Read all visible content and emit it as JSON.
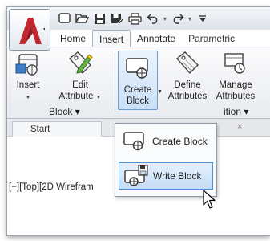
{
  "quick_access": {
    "icons": [
      "new-file-icon",
      "open-folder-icon",
      "save-icon",
      "save-as-icon",
      "print-icon",
      "undo-icon",
      "redo-icon",
      "customize-dropdown-icon"
    ]
  },
  "tabs": [
    {
      "label": "Home",
      "active": false
    },
    {
      "label": "Insert",
      "active": true
    },
    {
      "label": "Annotate",
      "active": false
    },
    {
      "label": "Parametric",
      "active": false
    }
  ],
  "ribbon": {
    "insert_label": "Insert",
    "edit_attr_line1": "Edit",
    "edit_attr_line2": "Attribute",
    "create_block_line1": "Create",
    "create_block_line2": "Block",
    "define_attr_line1": "Define",
    "define_attr_line2": "Attributes",
    "manage_attr_line1": "Manage",
    "manage_attr_line2": "Attributes",
    "panel_block": "Block ▾",
    "panel_definition": "ition ▾"
  },
  "document": {
    "tab_label": "Start",
    "viewport_label": "[−][Top][2D Wirefram"
  },
  "dropdown": {
    "items": [
      {
        "label": "Create Block",
        "highlighted": false
      },
      {
        "label": "Write Block",
        "highlighted": true
      }
    ]
  },
  "colors": {
    "autocad_red": "#c1272d",
    "highlight_blue": "#c4dcf5",
    "highlight_border": "#4a8fd6"
  }
}
